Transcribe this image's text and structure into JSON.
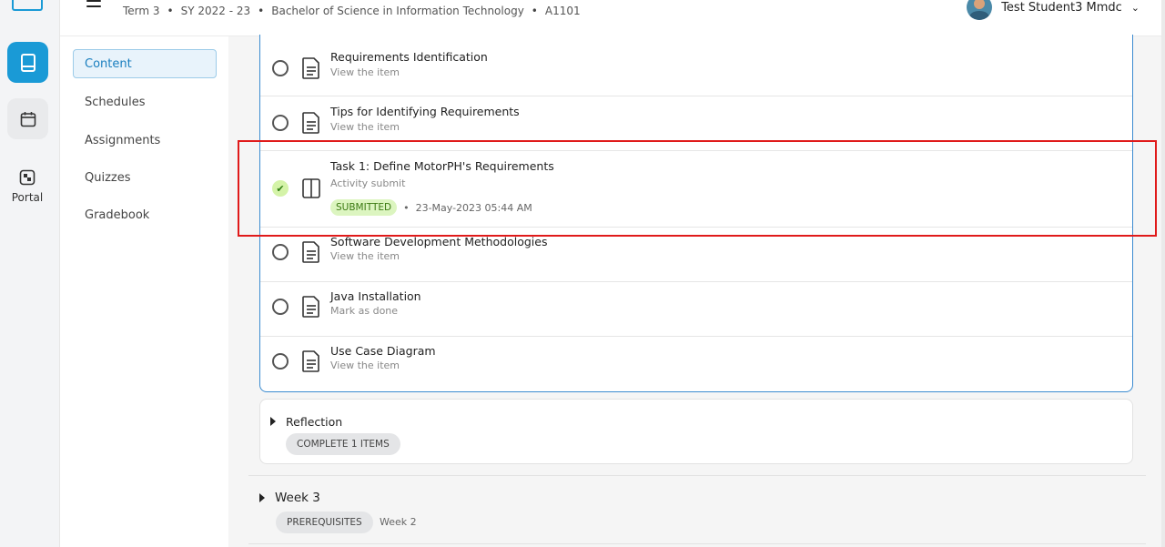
{
  "header": {
    "crumbs": [
      "Term 3",
      "SY 2022 - 23",
      "Bachelor of Science in Information Technology",
      "A1101"
    ],
    "separator": "•",
    "user_name": "Test Student3 Mmdc",
    "chevron": "⌄"
  },
  "rail": {
    "items": [
      {
        "icon": "book-icon",
        "active": true
      },
      {
        "icon": "calendar-icon",
        "active": false
      }
    ],
    "portal_label": "Portal"
  },
  "subnav": {
    "items": [
      {
        "label": "Content",
        "active": true
      },
      {
        "label": "Schedules",
        "active": false
      },
      {
        "label": "Assignments",
        "active": false
      },
      {
        "label": "Quizzes",
        "active": false
      },
      {
        "label": "Gradebook",
        "active": false
      }
    ]
  },
  "content_items": [
    {
      "title": "Requirements Identification",
      "subtitle": "View the item",
      "icon": "document-icon",
      "done": false
    },
    {
      "title": "Tips for Identifying Requirements",
      "subtitle": "View the item",
      "icon": "document-icon",
      "done": false
    },
    {
      "title": "Task 1: Define MotorPH's Requirements",
      "subtitle": "Activity submit",
      "icon": "split-panel-icon",
      "done": true,
      "badge": "SUBMITTED",
      "timestamp": "23-May-2023 05:44 AM"
    },
    {
      "title": "Software Development Methodologies",
      "subtitle": "View the item",
      "icon": "document-icon",
      "done": false
    },
    {
      "title": "Java Installation",
      "subtitle": "Mark as done",
      "icon": "document-icon",
      "done": false
    },
    {
      "title": "Use Case Diagram",
      "subtitle": "View the item",
      "icon": "document-icon",
      "done": false
    }
  ],
  "reflection": {
    "title": "Reflection",
    "pill": "COMPLETE 1 ITEMS"
  },
  "week3": {
    "title": "Week 3",
    "pill": "PREREQUISITES",
    "ref": "Week 2"
  },
  "colors": {
    "accent": "#1a9ad6",
    "panel_border": "#3b8bd0",
    "highlight": "#e01a1a",
    "submitted_bg": "#dcf5c0"
  }
}
